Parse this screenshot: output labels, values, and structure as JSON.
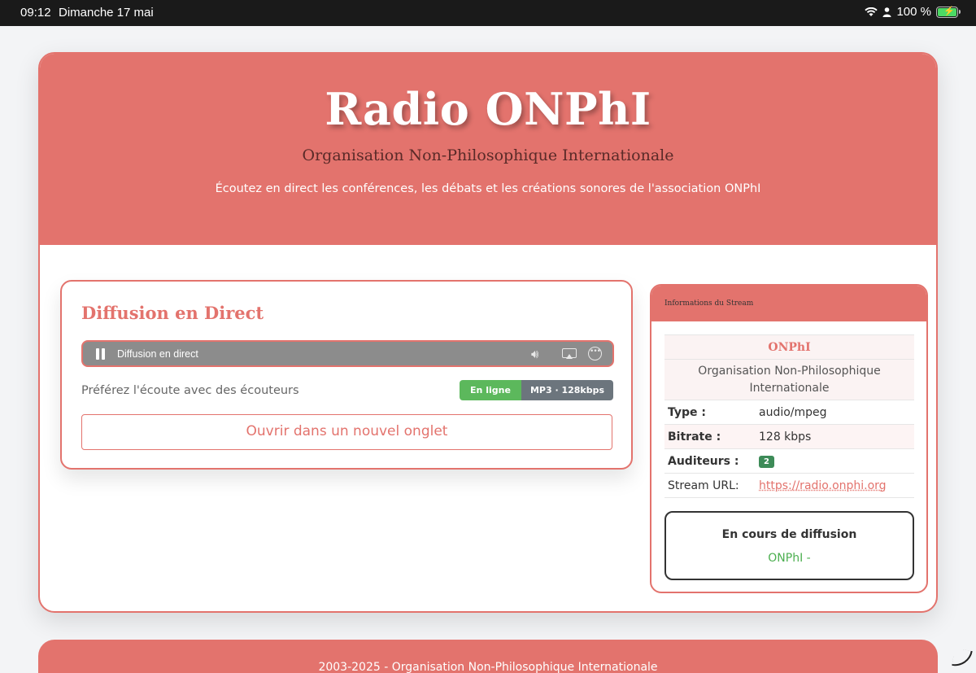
{
  "status_bar": {
    "time": "09:12",
    "date": "Dimanche 17 mai",
    "battery": "100 %"
  },
  "header": {
    "title": "Radio ONPhI",
    "subtitle": "Organisation Non-Philosophique Internationale",
    "tagline": "Écoutez en direct les conférences, les débats et les créations sonores de l'association ONPhI"
  },
  "player": {
    "heading": "Diffusion en Direct",
    "audio_label": "Diffusion en direct",
    "tip": "Préférez l'écoute avec des écouteurs",
    "status_badge": "En ligne",
    "format_badge": "MP3 · 128kbps",
    "open_button": "Ouvrir dans un nouvel onglet"
  },
  "info": {
    "heading": "Informations du Stream",
    "name": "ONPhI",
    "org_line1": "Organisation Non-Philosophique",
    "org_line2": "Internationale",
    "type_label": "Type :",
    "type_value": "audio/mpeg",
    "bitrate_label": "Bitrate :",
    "bitrate_value": "128 kbps",
    "listeners_label": "Auditeurs :",
    "listeners_value": "2",
    "url_label": "Stream URL:",
    "url_value": "https://radio.onphi.org",
    "now_label": "En cours de diffusion",
    "now_track": "ONPhI -"
  },
  "footer": {
    "text": "2003-2025 - Organisation Non-Philosophique Internationale"
  },
  "colors": {
    "accent": "#e3736d",
    "online": "#5cb85c",
    "format": "#6c757d",
    "listeners": "#3d8b58",
    "playing": "#4caf50"
  }
}
